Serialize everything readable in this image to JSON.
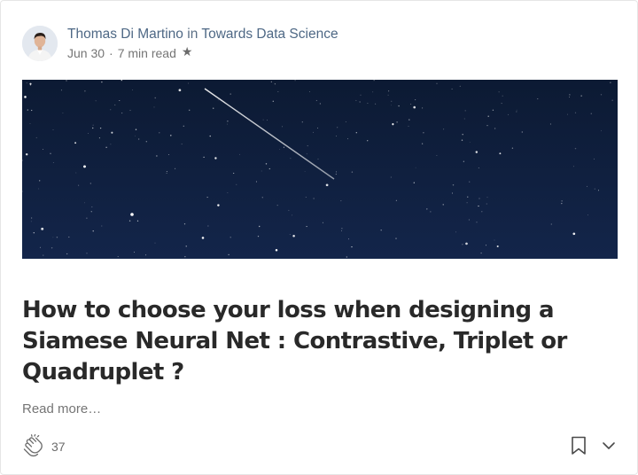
{
  "post": {
    "author": "Thomas Di Martino",
    "in_word": "in",
    "publication": "Towards Data Science",
    "date": "Jun 30",
    "separator": "·",
    "read_time": "7 min read",
    "title": "How to choose your loss when designing a Siamese Neural Net : Contrastive, Triplet or Quadruplet ?",
    "read_more": "Read more…",
    "clap_count": "37",
    "member_only_icon": "star-icon",
    "clap_icon": "clap-icon",
    "bookmark_icon": "bookmark-icon",
    "more_icon": "chevron-down-icon",
    "hero_image": "night-sky-with-stars-and-meteor"
  },
  "colors": {
    "author_link": "#4e6885",
    "meta_text": "#757575",
    "title_text": "#292929",
    "hero_background": "#0f1d38"
  }
}
